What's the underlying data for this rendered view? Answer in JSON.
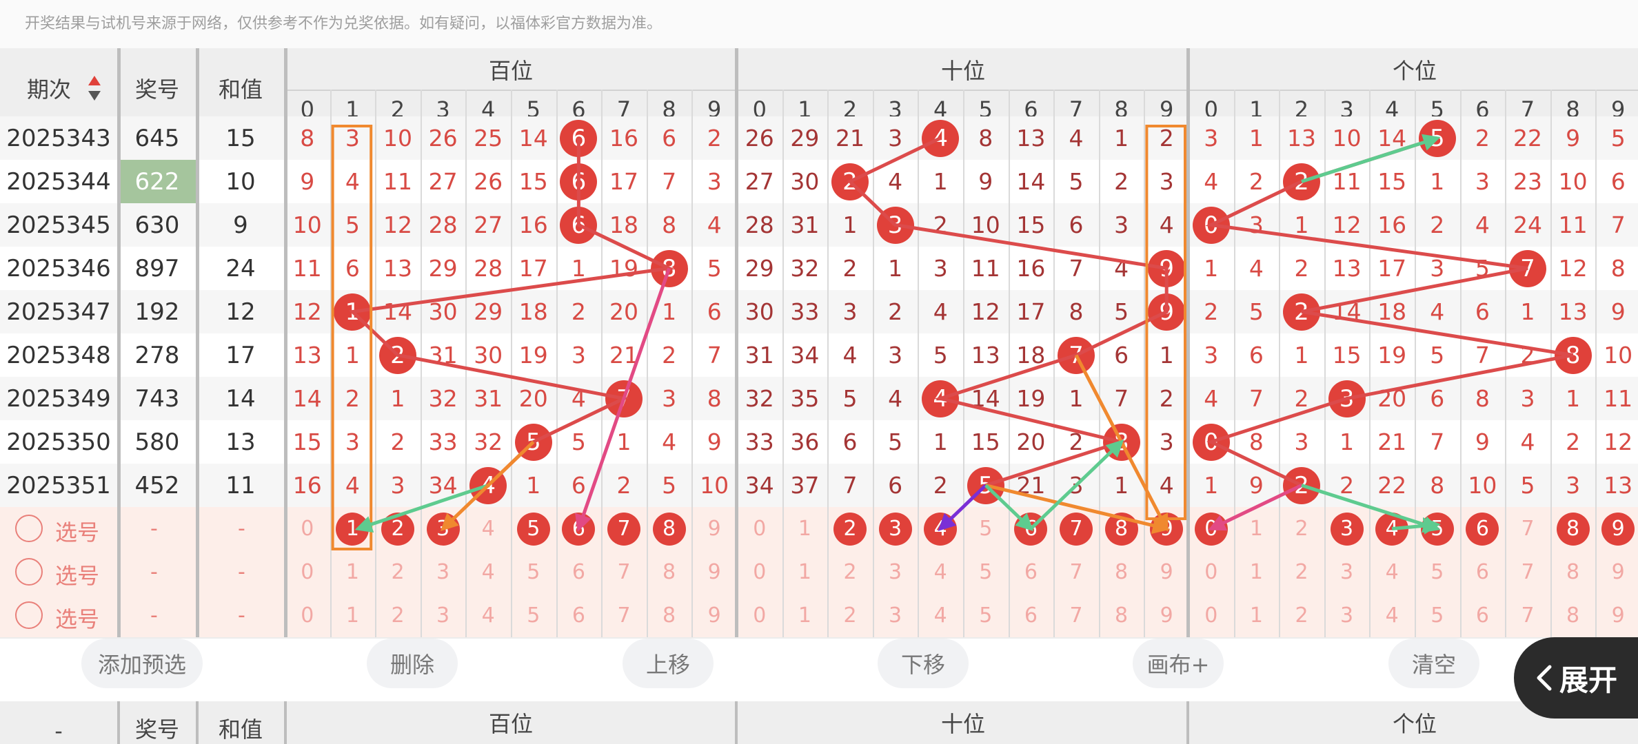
{
  "notice": "开奖结果与试机号来源于网络，仅供参考不作为兑奖依据。如有疑问，以福体彩官方数据为准。",
  "header": {
    "period": "期次",
    "number": "奖号",
    "sum": "和值",
    "groups": [
      "百位",
      "十位",
      "个位"
    ],
    "digits": [
      "0",
      "1",
      "2",
      "3",
      "4",
      "5",
      "6",
      "7",
      "8",
      "9"
    ]
  },
  "rows": [
    {
      "period": "2025343",
      "number": "645",
      "sum": "15",
      "cols": [
        [
          "8",
          "3",
          "10",
          "26",
          "25",
          "14",
          "6",
          "16",
          "6",
          "2"
        ],
        [
          "26",
          "29",
          "21",
          "3",
          "4",
          "8",
          "13",
          "4",
          "1",
          "2"
        ],
        [
          "3",
          "1",
          "13",
          "10",
          "14",
          "5",
          "2",
          "22",
          "9",
          "5"
        ]
      ],
      "balls": [
        6,
        4,
        5
      ]
    },
    {
      "period": "2025344",
      "number": "622",
      "sum": "10",
      "cols": [
        [
          "9",
          "4",
          "11",
          "27",
          "26",
          "15",
          "6",
          "17",
          "7",
          "3"
        ],
        [
          "27",
          "30",
          "2",
          "4",
          "1",
          "9",
          "14",
          "5",
          "2",
          "3"
        ],
        [
          "4",
          "2",
          "2",
          "11",
          "15",
          "1",
          "3",
          "23",
          "10",
          "6"
        ]
      ],
      "balls": [
        6,
        2,
        2
      ],
      "highlight": true
    },
    {
      "period": "2025345",
      "number": "630",
      "sum": "9",
      "cols": [
        [
          "10",
          "5",
          "12",
          "28",
          "27",
          "16",
          "6",
          "18",
          "8",
          "4"
        ],
        [
          "28",
          "31",
          "1",
          "3",
          "2",
          "10",
          "15",
          "6",
          "3",
          "4"
        ],
        [
          "0",
          "3",
          "1",
          "12",
          "16",
          "2",
          "4",
          "24",
          "11",
          "7"
        ]
      ],
      "balls": [
        6,
        3,
        0
      ]
    },
    {
      "period": "2025346",
      "number": "897",
      "sum": "24",
      "cols": [
        [
          "11",
          "6",
          "13",
          "29",
          "28",
          "17",
          "1",
          "19",
          "8",
          "5"
        ],
        [
          "29",
          "32",
          "2",
          "1",
          "3",
          "11",
          "16",
          "7",
          "4",
          "9"
        ],
        [
          "1",
          "4",
          "2",
          "13",
          "17",
          "3",
          "5",
          "7",
          "12",
          "8"
        ]
      ],
      "balls": [
        8,
        9,
        7
      ]
    },
    {
      "period": "2025347",
      "number": "192",
      "sum": "12",
      "cols": [
        [
          "12",
          "1",
          "14",
          "30",
          "29",
          "18",
          "2",
          "20",
          "1",
          "6"
        ],
        [
          "30",
          "33",
          "3",
          "2",
          "4",
          "12",
          "17",
          "8",
          "5",
          "9"
        ],
        [
          "2",
          "5",
          "2",
          "14",
          "18",
          "4",
          "6",
          "1",
          "13",
          "9"
        ]
      ],
      "balls": [
        1,
        9,
        2
      ]
    },
    {
      "period": "2025348",
      "number": "278",
      "sum": "17",
      "cols": [
        [
          "13",
          "1",
          "2",
          "31",
          "30",
          "19",
          "3",
          "21",
          "2",
          "7"
        ],
        [
          "31",
          "34",
          "4",
          "3",
          "5",
          "13",
          "18",
          "7",
          "6",
          "1"
        ],
        [
          "3",
          "6",
          "1",
          "15",
          "19",
          "5",
          "7",
          "2",
          "8",
          "10"
        ]
      ],
      "balls": [
        2,
        7,
        8
      ]
    },
    {
      "period": "2025349",
      "number": "743",
      "sum": "14",
      "cols": [
        [
          "14",
          "2",
          "1",
          "32",
          "31",
          "20",
          "4",
          "7",
          "3",
          "8"
        ],
        [
          "32",
          "35",
          "5",
          "4",
          "4",
          "14",
          "19",
          "1",
          "7",
          "2"
        ],
        [
          "4",
          "7",
          "2",
          "3",
          "20",
          "6",
          "8",
          "3",
          "1",
          "11"
        ]
      ],
      "balls": [
        7,
        4,
        3
      ]
    },
    {
      "period": "2025350",
      "number": "580",
      "sum": "13",
      "cols": [
        [
          "15",
          "3",
          "2",
          "33",
          "32",
          "5",
          "5",
          "1",
          "4",
          "9"
        ],
        [
          "33",
          "36",
          "6",
          "5",
          "1",
          "15",
          "20",
          "2",
          "8",
          "3"
        ],
        [
          "0",
          "8",
          "3",
          "1",
          "21",
          "7",
          "9",
          "4",
          "2",
          "12"
        ]
      ],
      "balls": [
        5,
        8,
        0
      ]
    },
    {
      "period": "2025351",
      "number": "452",
      "sum": "11",
      "cols": [
        [
          "16",
          "4",
          "3",
          "34",
          "4",
          "1",
          "6",
          "2",
          "5",
          "10"
        ],
        [
          "34",
          "37",
          "7",
          "6",
          "2",
          "5",
          "21",
          "3",
          "1",
          "4"
        ],
        [
          "1",
          "9",
          "2",
          "2",
          "22",
          "8",
          "10",
          "5",
          "3",
          "13"
        ]
      ],
      "balls": [
        4,
        5,
        2
      ]
    }
  ],
  "selection_rows": [
    {
      "label": "选号",
      "number": "-",
      "sum": "-",
      "selected": [
        [
          1,
          2,
          3,
          5,
          6,
          7,
          8
        ],
        [
          2,
          3,
          4,
          6,
          7,
          8,
          9
        ],
        [
          0,
          3,
          4,
          5,
          6,
          8,
          9
        ]
      ]
    },
    {
      "label": "选号",
      "number": "-",
      "sum": "-",
      "selected": [
        [],
        [],
        []
      ]
    },
    {
      "label": "选号",
      "number": "-",
      "sum": "-",
      "selected": [
        [],
        [],
        []
      ]
    }
  ],
  "buttons": {
    "add": "添加预选",
    "delete": "删除",
    "up": "上移",
    "down": "下移",
    "canvas": "画布+",
    "clear": "清空",
    "expand": "展开"
  },
  "footer": {
    "period": "-",
    "number": "奖号",
    "sum": "和值",
    "groups": [
      "百位",
      "十位",
      "个位"
    ]
  },
  "colors": {
    "ball": "#e0413a",
    "highlight_cell": "#a5c59d",
    "selection_bg": "#fdeee9",
    "line_red": "#dc4b4b",
    "line_orange": "#f0892f",
    "line_green": "#5ecb8f",
    "line_pink": "#e24a84",
    "line_purple": "#7a2fd6",
    "rect_orange": "#f0892f"
  },
  "icons": {
    "sort": "sort-arrows-icon",
    "expand": "chevron-left-icon",
    "radio": "radio-icon"
  }
}
